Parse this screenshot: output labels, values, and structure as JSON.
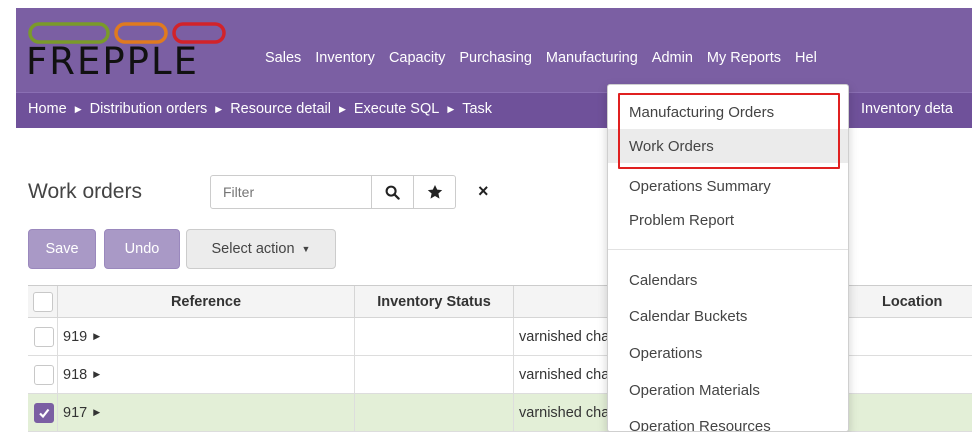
{
  "brand": {
    "logo_text": "FREPPLE",
    "ring_colors": [
      "#7a9a2a",
      "#e07a1f",
      "#d2232a"
    ]
  },
  "main_nav": [
    "Sales",
    "Inventory",
    "Capacity",
    "Purchasing",
    "Manufacturing",
    "Admin",
    "My Reports",
    "Hel"
  ],
  "breadcrumbs": [
    "Home",
    "Distribution orders",
    "Resource detail",
    "Execute SQL",
    "Task"
  ],
  "breadcrumb_tail": "Inventory deta",
  "page": {
    "title": "Work orders",
    "filter_placeholder": "Filter",
    "clear_icon": "×"
  },
  "buttons": {
    "save": "Save",
    "undo": "Undo",
    "select_action": "Select action"
  },
  "grid": {
    "columns": [
      "Reference",
      "Inventory Status",
      "I",
      "Location"
    ],
    "rows": [
      {
        "reference": "919",
        "inventory_status": "",
        "item": "varnished cha",
        "checked": false
      },
      {
        "reference": "918",
        "inventory_status": "",
        "item": "varnished cha",
        "checked": false
      },
      {
        "reference": "917",
        "inventory_status": "",
        "item": "varnished cha",
        "checked": true
      }
    ]
  },
  "manufacturing_menu": {
    "group1": [
      "Manufacturing Orders",
      "Work Orders",
      "Operations Summary",
      "Problem Report"
    ],
    "group2": [
      "Calendars",
      "Calendar Buckets",
      "Operations",
      "Operation Materials",
      "Operation Resources"
    ],
    "highlight_color": "#e02020"
  },
  "colors": {
    "header": "#7b5fa3",
    "breadcrumb_bar": "#6f519a",
    "button_primary": "#a999c6",
    "selected_row": "#e3efd7"
  }
}
